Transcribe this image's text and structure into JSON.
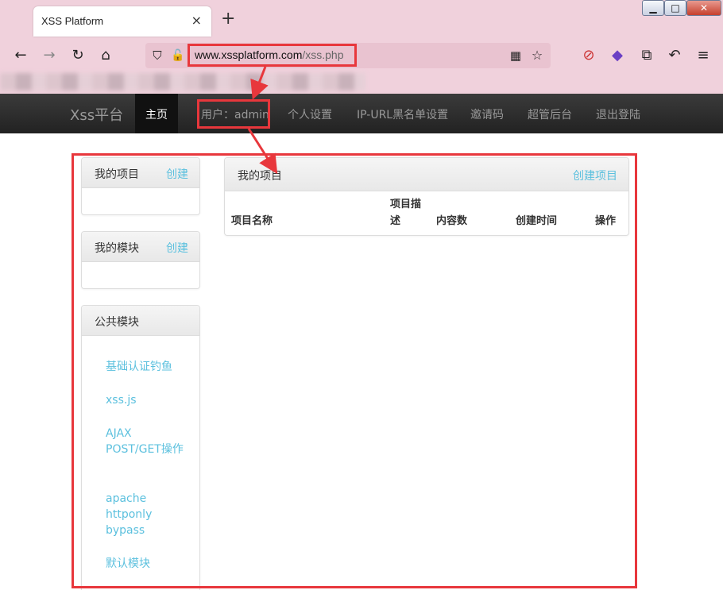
{
  "browser": {
    "tab_title": "XSS Platform",
    "tab_close": "×",
    "new_tab": "+",
    "url_host": "www.xssplatform.com",
    "url_path": "/xss.php",
    "window_controls": {
      "minimize": "▁",
      "maximize": "□",
      "close": "✕"
    }
  },
  "navbar": {
    "brand": "Xss平台",
    "home": "主页",
    "user": "用户：admin",
    "settings": "个人设置",
    "blacklist": "IP-URL黑名单设置",
    "invite": "邀请码",
    "admin": "超管后台",
    "logout": "退出登陆"
  },
  "sidebar": {
    "my_projects": {
      "title": "我的项目",
      "action": "创建"
    },
    "my_modules": {
      "title": "我的模块",
      "action": "创建"
    },
    "public_modules": {
      "title": "公共模块",
      "items": [
        "基础认证钓鱼",
        "xss.js",
        "AJAX POST/GET操作",
        "apache httponly bypass",
        "默认模块"
      ]
    }
  },
  "main": {
    "title": "我的项目",
    "create": "创建项目",
    "columns": [
      "项目名称",
      "项目描述",
      "内容数",
      "创建时间",
      "操作"
    ]
  },
  "colors": {
    "accent": "#5bc0de",
    "annotation": "#e8373c",
    "navbar": "#222222"
  }
}
